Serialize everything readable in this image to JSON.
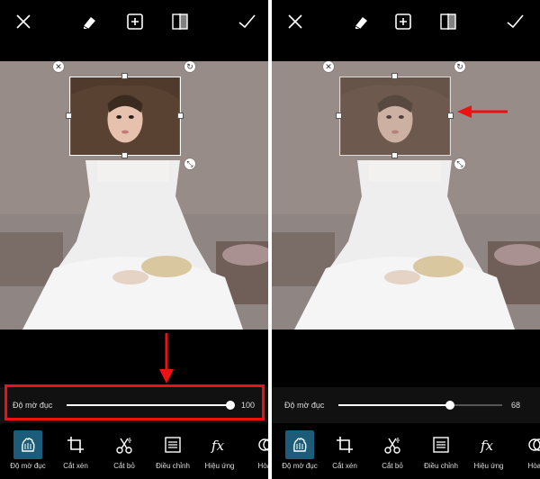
{
  "toolbar": {
    "icons": [
      "close-icon",
      "eraser-icon",
      "add-icon",
      "flip-icon",
      "check-icon"
    ]
  },
  "left_panel": {
    "slider": {
      "label": "Độ mờ đục",
      "value": "100",
      "level": 1.0
    }
  },
  "right_panel": {
    "slider": {
      "label": "Độ mờ đục",
      "value": "68",
      "level": 0.68
    }
  },
  "tools": [
    {
      "label": "Độ mờ đục",
      "icon": "opacity-icon",
      "active": true
    },
    {
      "label": "Cắt xén",
      "icon": "crop-icon",
      "active": false
    },
    {
      "label": "Cắt bỏ",
      "icon": "cutout-icon",
      "active": false
    },
    {
      "label": "Điều chỉnh",
      "icon": "adjust-icon",
      "active": false
    },
    {
      "label": "Hiệu ứng",
      "icon": "fx-icon",
      "active": false
    },
    {
      "label": "Hòa t",
      "icon": "blend-icon",
      "active": false
    }
  ],
  "colors": {
    "accent": "#1c5c78",
    "highlight": "#e11111",
    "background": "#000000"
  }
}
